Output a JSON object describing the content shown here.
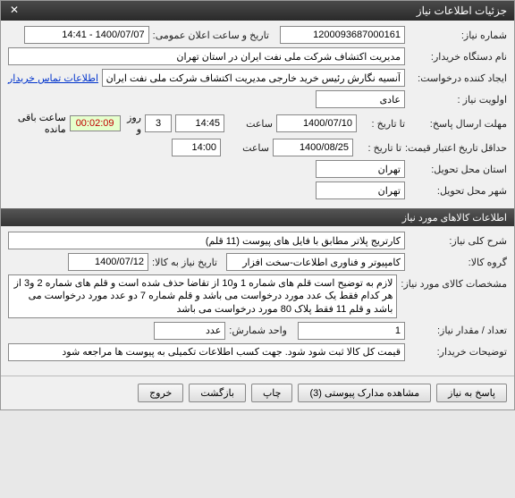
{
  "title_bar": {
    "title": "جزئیات اطلاعات نیاز"
  },
  "need_info": {
    "need_no_label": "شماره نیاز:",
    "need_no": "1200093687000161",
    "pub_date_label": "تاریخ و ساعت اعلان عمومی:",
    "pub_date": "1400/07/07 - 14:41",
    "buyer_org_label": "نام دستگاه خریدار:",
    "buyer_org": "مدیریت اکتشاف شرکت ملی نفت ایران در استان تهران",
    "requester_label": "ایجاد کننده درخواست:",
    "requester": "آنسیه نگارش رئیس خرید خارجی مدیریت اکتشاف شرکت ملی نفت ایران در است",
    "contact_link": "اطلاعات تماس خریدار",
    "priority_label": "اولویت نیاز :",
    "priority": "عادی",
    "reply_deadline_label": "مهلت ارسال پاسخ:",
    "until_label": "تا تاریخ :",
    "reply_date": "1400/07/10",
    "time_label": "ساعت",
    "reply_time": "14:45",
    "days_remaining": "3",
    "days_label": "روز و",
    "countdown": "00:02:09",
    "remaining_label": "ساعت باقی مانده",
    "min_validity_label": "حداقل تاریخ اعتبار قیمت:",
    "min_validity_date": "1400/08/25",
    "min_validity_time": "14:00",
    "delivery_province_label": "استان محل تحویل:",
    "delivery_province": "تهران",
    "delivery_city_label": "شهر محل تحویل:",
    "delivery_city": "تهران"
  },
  "goods_header": "اطلاعات کالاهای مورد نیاز",
  "goods": {
    "desc_label": "شرح کلی نیاز:",
    "desc": "کارتریج پلاتر مطابق با فایل های پیوست (11 قلم)",
    "group_label": "گروه کالا:",
    "group": "کامپیوتر و فناوری اطلاعات-سخت افزار",
    "need_date_label": "تاریخ نیاز به کالا:",
    "need_date": "1400/07/12",
    "spec_label": "مشخصات کالای مورد نیاز:",
    "spec": "لازم به توضیح است قلم های شماره 1 و10 از تقاضا حذف شده است و قلم های شماره 2 و3 از هر کدام فقط یک عدد مورد درخواست می باشد و قلم شماره 7 دو عدد مورد درخواست می باشد و قلم 11 فقط پلاک 80 مورد درخواست می باشد",
    "qty_label": "تعداد / مقدار نیاز:",
    "qty": "1",
    "unit_label": "واحد شمارش:",
    "unit": "عدد",
    "buyer_notes_label": "توضیحات خریدار:",
    "buyer_notes": "قیمت کل کالا ثبت شود شود. جهت کسب اطلاعات تکمیلی به پیوست ها مراجعه شود"
  },
  "buttons": {
    "reply": "پاسخ به نیاز",
    "attachments": "مشاهده مدارک پیوستی (3)",
    "print": "چاپ",
    "back": "بازگشت",
    "exit": "خروج"
  }
}
